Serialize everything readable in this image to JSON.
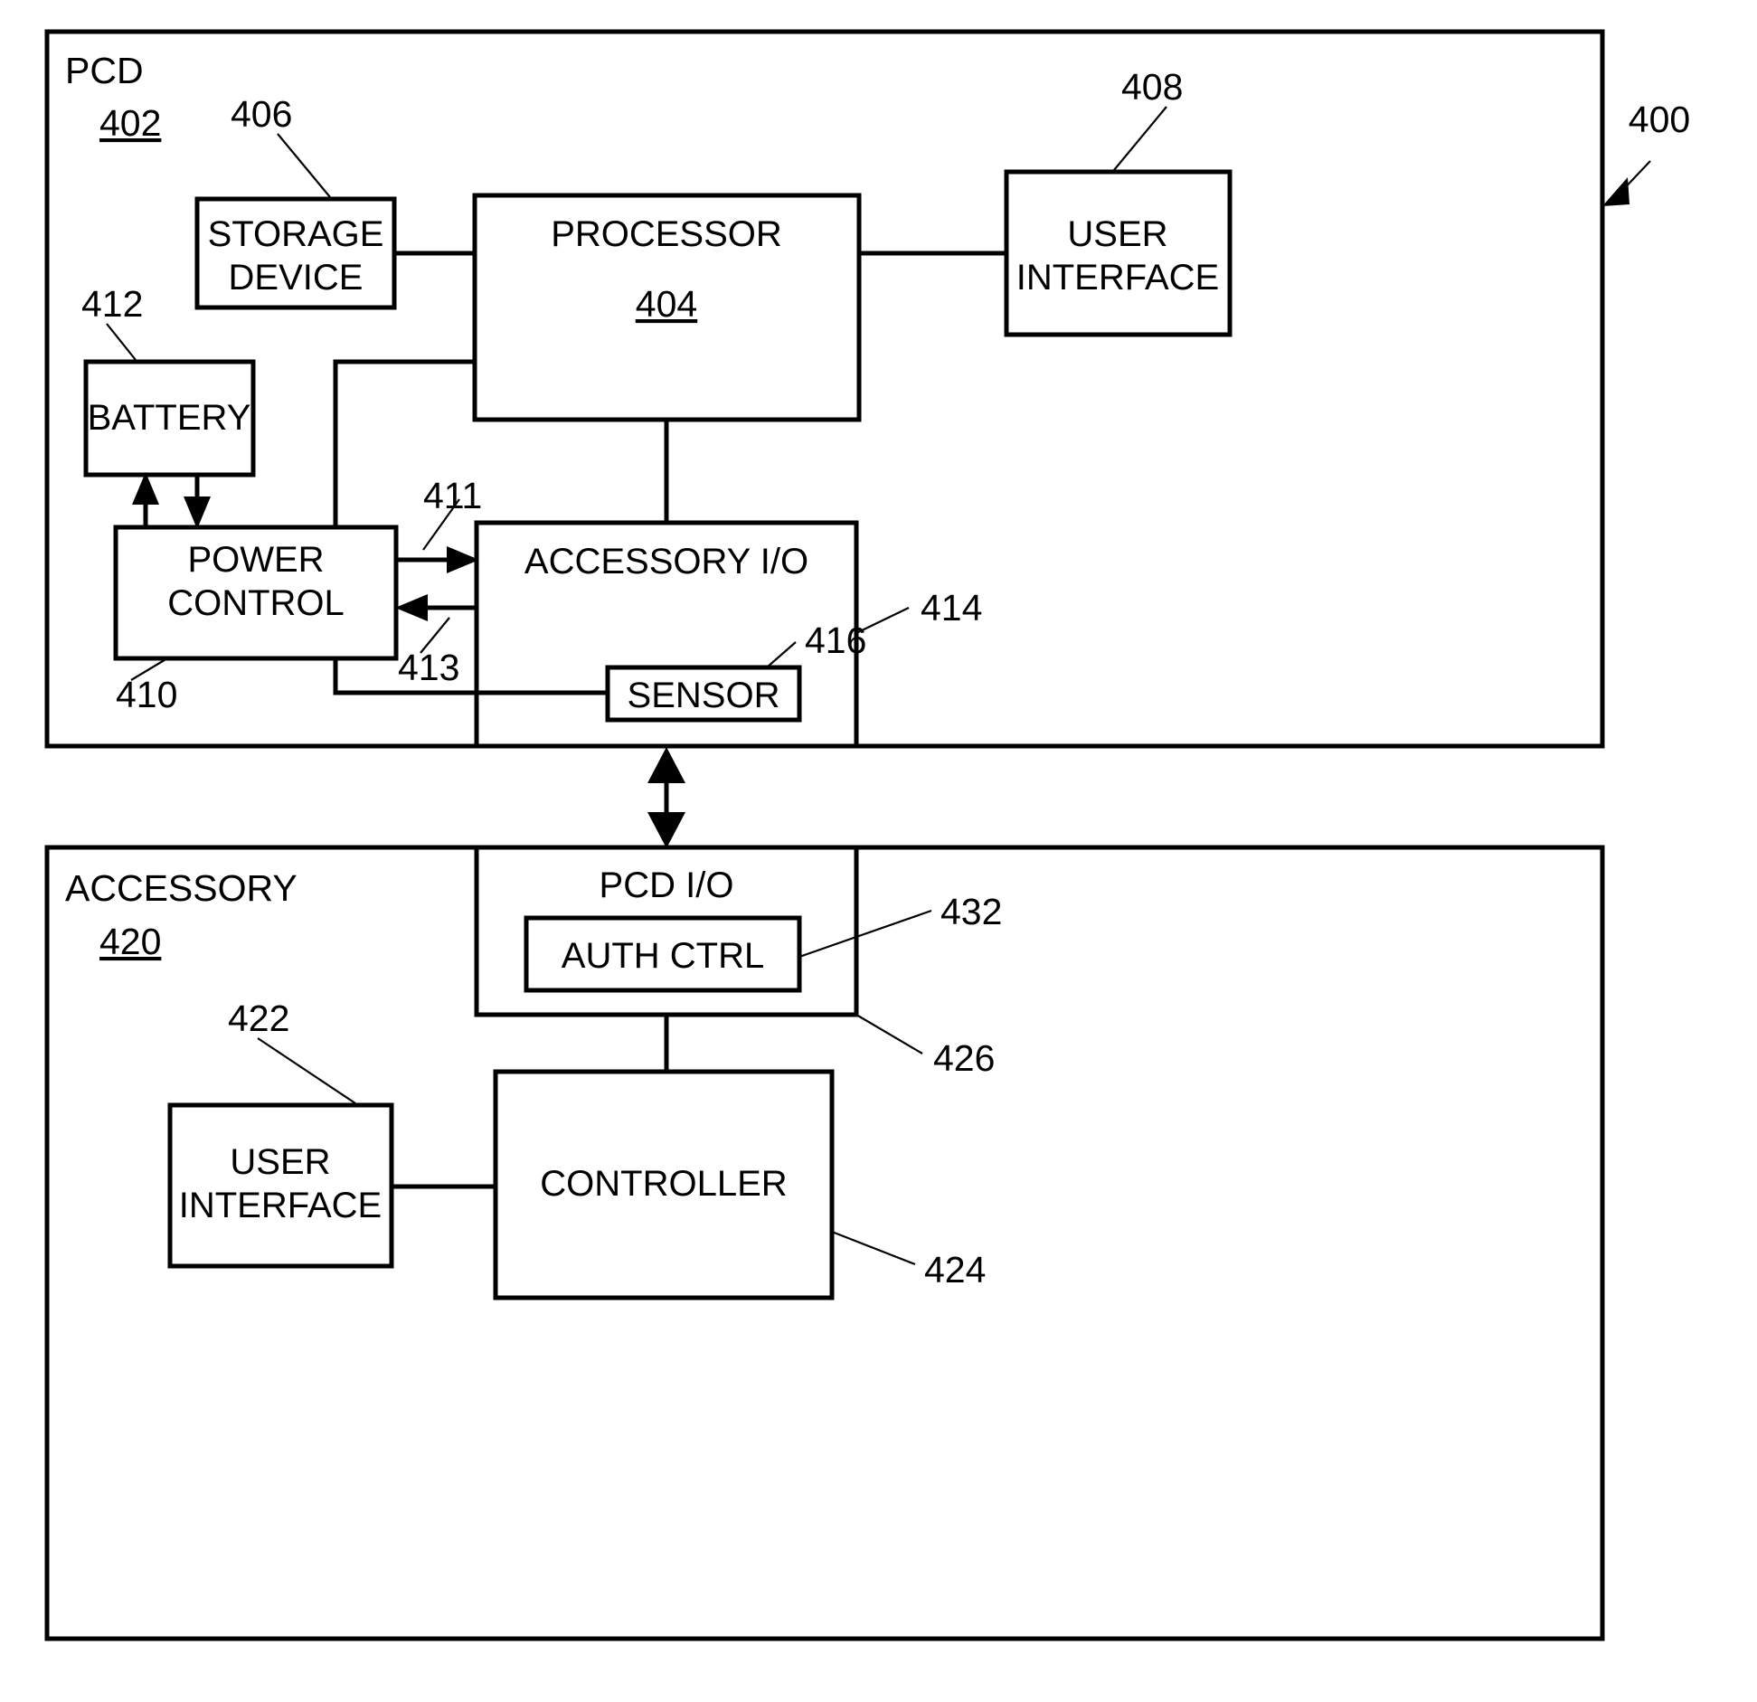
{
  "figure": {
    "reference_number": "400"
  },
  "pcd": {
    "title": "PCD",
    "ref": "402",
    "blocks": {
      "storage_device": {
        "label_line1": "STORAGE",
        "label_line2": "DEVICE",
        "ref": "406"
      },
      "processor": {
        "label": "PROCESSOR",
        "ref": "404"
      },
      "user_interface": {
        "label_line1": "USER",
        "label_line2": "INTERFACE",
        "ref": "408"
      },
      "battery": {
        "label": "BATTERY",
        "ref": "412"
      },
      "power_control": {
        "label_line1": "POWER",
        "label_line2": "CONTROL",
        "ref": "410"
      },
      "accessory_io": {
        "label": "ACCESSORY I/O",
        "ref": "414"
      },
      "sensor": {
        "label": "SENSOR",
        "ref": "416"
      }
    },
    "signals": {
      "power_to_io": "411",
      "io_to_power": "413"
    }
  },
  "accessory": {
    "title": "ACCESSORY",
    "ref": "420",
    "blocks": {
      "pcd_io": {
        "label": "PCD I/O",
        "ref": "426"
      },
      "auth_ctrl": {
        "label": "AUTH CTRL",
        "ref": "432"
      },
      "user_interface": {
        "label_line1": "USER",
        "label_line2": "INTERFACE",
        "ref": "422"
      },
      "controller": {
        "label": "CONTROLLER",
        "ref": "424"
      }
    }
  }
}
